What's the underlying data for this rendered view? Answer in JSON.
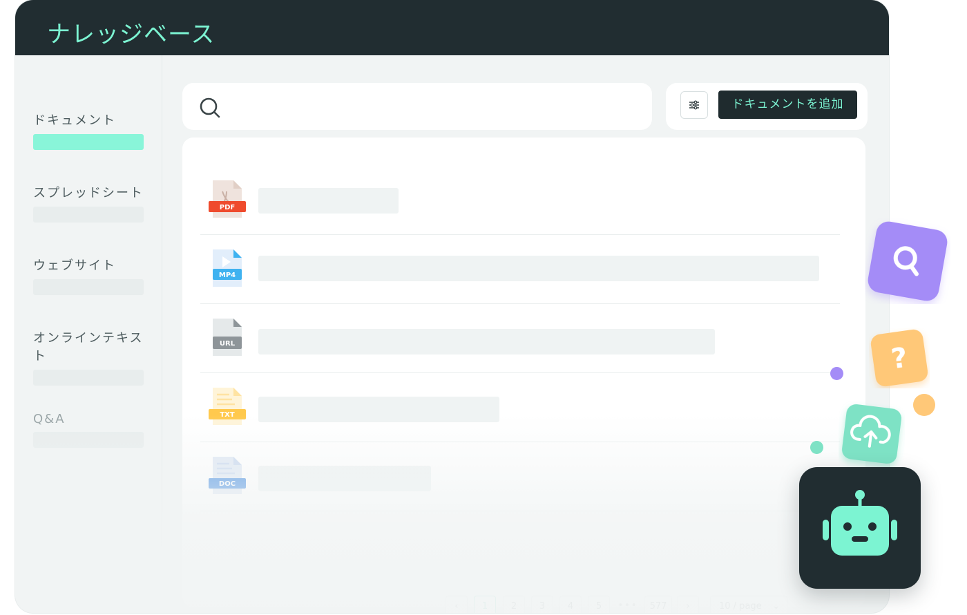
{
  "header": {
    "title": "ナレッジベース"
  },
  "sidebar": {
    "items": [
      {
        "label": "ドキュメント",
        "active": true
      },
      {
        "label": "スプレッドシート",
        "active": false
      },
      {
        "label": "ウェブサイト",
        "active": false
      },
      {
        "label": "オンラインテキスト",
        "active": false
      },
      {
        "label": "Q&A",
        "active": false
      }
    ]
  },
  "search": {
    "placeholder": "",
    "value": ""
  },
  "toolbar": {
    "add_label": "ドキュメントを追加"
  },
  "files": [
    {
      "type_label": "PDF",
      "color": "#ef4b2d"
    },
    {
      "type_label": "MP4",
      "color": "#3fb2f0"
    },
    {
      "type_label": "URL",
      "color": "#8e9599"
    },
    {
      "type_label": "TXT",
      "color": "#ffc94d"
    },
    {
      "type_label": "DOC",
      "color": "#4a90e2"
    }
  ],
  "pagination": {
    "pages": [
      "1",
      "2",
      "3",
      "4",
      "5"
    ],
    "ellipsis": "•••",
    "last_page": "577",
    "current": 1,
    "page_size": "10 / page"
  },
  "floating_icons": [
    {
      "icon": "magnifier-icon",
      "color": "#a48cf7"
    },
    {
      "icon": "question-mark-icon",
      "color": "#ffc878"
    },
    {
      "icon": "cloud-upload-icon",
      "color": "#7ee2c5"
    },
    {
      "icon": "robot-icon",
      "color": "#212d31"
    }
  ],
  "colors": {
    "accent": "#7cf4d2",
    "titlebar": "#212d31",
    "active_bar": "#89f5d9"
  }
}
